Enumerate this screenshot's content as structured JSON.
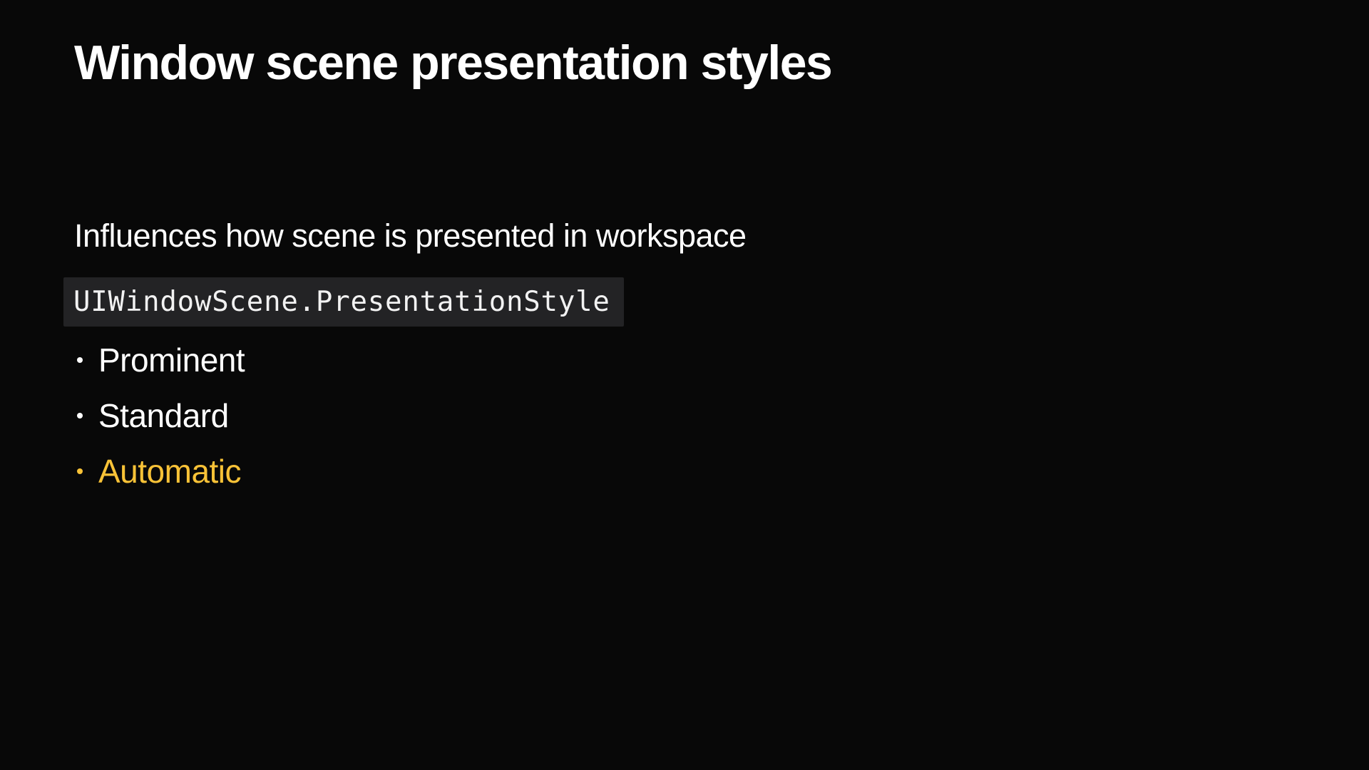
{
  "slide": {
    "title": "Window scene presentation styles",
    "subtitle": "Influences how scene is presented in workspace",
    "code": "UIWindowScene.PresentationStyle",
    "bullets": [
      {
        "label": "Prominent",
        "highlighted": false
      },
      {
        "label": "Standard",
        "highlighted": false
      },
      {
        "label": "Automatic",
        "highlighted": true
      }
    ]
  },
  "colors": {
    "background": "#080808",
    "text": "#ffffff",
    "code_background": "#232325",
    "highlight": "#f8c237"
  }
}
